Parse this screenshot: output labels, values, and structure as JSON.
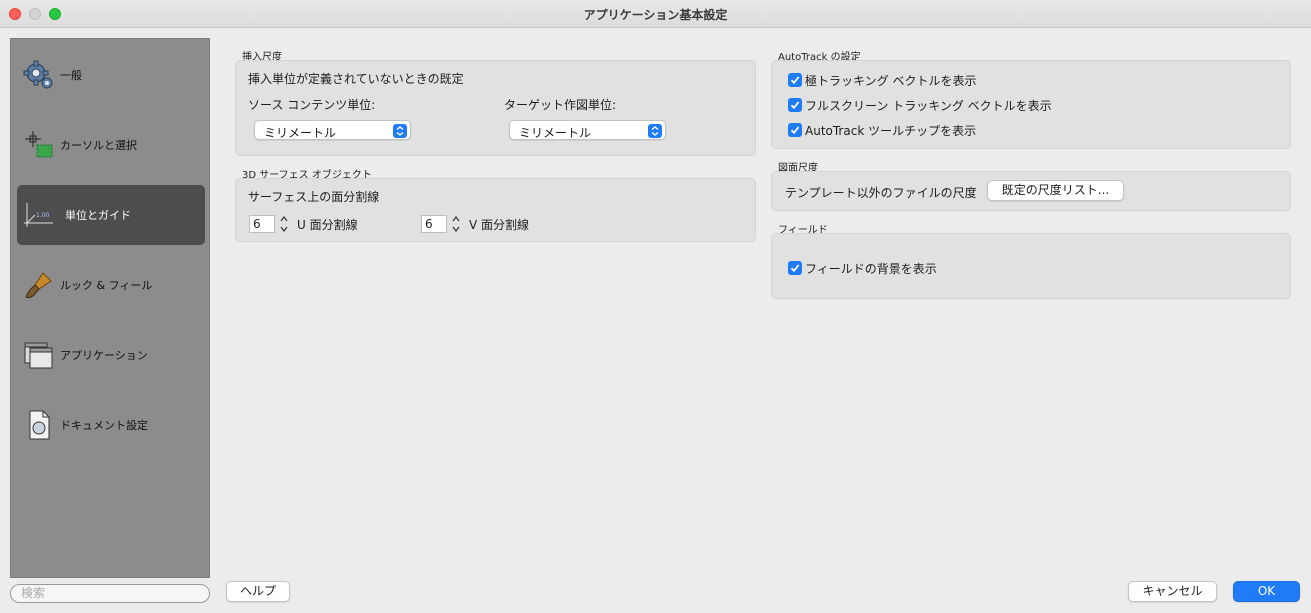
{
  "window": {
    "title": "アプリケーション基本設定"
  },
  "sidebar": {
    "items": [
      {
        "label": "一般",
        "icon": "gear-icon"
      },
      {
        "label": "カーソルと選択",
        "icon": "cursor-selection-icon"
      },
      {
        "label": "単位とガイド",
        "icon": "units-guide-icon",
        "selected": true
      },
      {
        "label": "ルック & フィール",
        "icon": "brush-icon"
      },
      {
        "label": "アプリケーション",
        "icon": "windows-icon"
      },
      {
        "label": "ドキュメント設定",
        "icon": "document-icon"
      }
    ],
    "search_placeholder": "検索"
  },
  "insert_scale": {
    "title": "挿入尺度",
    "subtitle": "挿入単位が定義されていないときの既定",
    "source_label": "ソース コンテンツ単位:",
    "source_value": "ミリメートル",
    "target_label": "ターゲット作図単位:",
    "target_value": "ミリメートル"
  },
  "surface_3d": {
    "title": "3D サーフェス オブジェクト",
    "subtitle": "サーフェス上の面分割線",
    "u_value": "6",
    "u_label": "U 面分割線",
    "v_value": "6",
    "v_label": "V 面分割線"
  },
  "autotrack": {
    "title": "AutoTrack の設定",
    "options": [
      {
        "label": "極トラッキング ベクトルを表示",
        "checked": true
      },
      {
        "label": "フルスクリーン トラッキング ベクトルを表示",
        "checked": true
      },
      {
        "label": "AutoTrack ツールチップを表示",
        "checked": true
      }
    ]
  },
  "drawing_scale": {
    "title": "図面尺度",
    "label": "テンプレート以外のファイルの尺度",
    "button": "既定の尺度リスト..."
  },
  "fields": {
    "title": "フィールド",
    "option": {
      "label": "フィールドの背景を表示",
      "checked": true
    }
  },
  "footer": {
    "help": "ヘルプ",
    "cancel": "キャンセル",
    "ok": "OK"
  },
  "colors": {
    "accent": "#1f7bf6",
    "sidebar_bg": "#8c8c8c",
    "sidebar_selected": "#4d4d4d"
  }
}
